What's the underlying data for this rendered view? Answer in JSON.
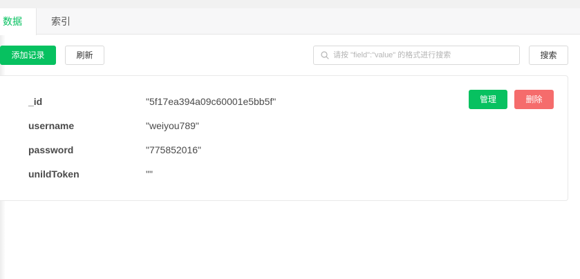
{
  "tabs": [
    {
      "label": "数据",
      "active": true
    },
    {
      "label": "索引",
      "active": false
    }
  ],
  "toolbar": {
    "add_label": "添加记录",
    "refresh_label": "刷新",
    "search_placeholder": "请按 \"field\":\"value\" 的格式进行搜索",
    "search_value": "",
    "search_label": "搜索"
  },
  "record": {
    "fields": [
      {
        "key": "_id",
        "value": "\"5f17ea394a09c60001e5bb5f\""
      },
      {
        "key": "username",
        "value": "\"weiyou789\""
      },
      {
        "key": "password",
        "value": "\"775852016\""
      },
      {
        "key": "unildToken",
        "value": "\"\""
      }
    ],
    "manage_label": "管理",
    "delete_label": "删除"
  },
  "colors": {
    "accent": "#07c160",
    "danger": "#f56c6c"
  },
  "icons": {
    "search": "search-icon"
  }
}
